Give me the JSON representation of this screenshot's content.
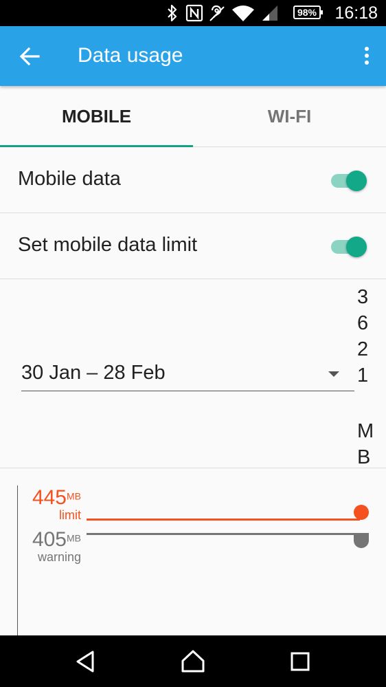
{
  "status_bar": {
    "battery": "98%",
    "clock": "16:18",
    "icons": [
      "bluetooth-icon",
      "nfc-icon",
      "hearing-aid-icon",
      "wifi-icon",
      "cell-signal-icon",
      "battery-icon"
    ]
  },
  "app_bar": {
    "title": "Data usage",
    "back_icon": "arrow-back-icon",
    "overflow_icon": "more-vert-icon"
  },
  "tabs": [
    {
      "label": "MOBILE",
      "selected": true
    },
    {
      "label": "WI-FI",
      "selected": false
    }
  ],
  "settings": {
    "mobile_data": {
      "label": "Mobile data",
      "on": true
    },
    "data_limit": {
      "label": "Set mobile data limit",
      "on": true
    }
  },
  "cycle": {
    "range": "30 Jan – 28 Feb",
    "usage_digits": [
      "3",
      "6",
      "2",
      "1"
    ],
    "usage_unit_chars": [
      "M",
      "B"
    ]
  },
  "chart": {
    "limit": {
      "value": "445",
      "unit": "MB",
      "label": "limit"
    },
    "warning": {
      "value": "405",
      "unit": "MB",
      "label": "warning"
    }
  },
  "colors": {
    "app_bar": "#2aa2e8",
    "accent": "#14a085",
    "limit": "#f4511e",
    "warning": "#757575"
  }
}
